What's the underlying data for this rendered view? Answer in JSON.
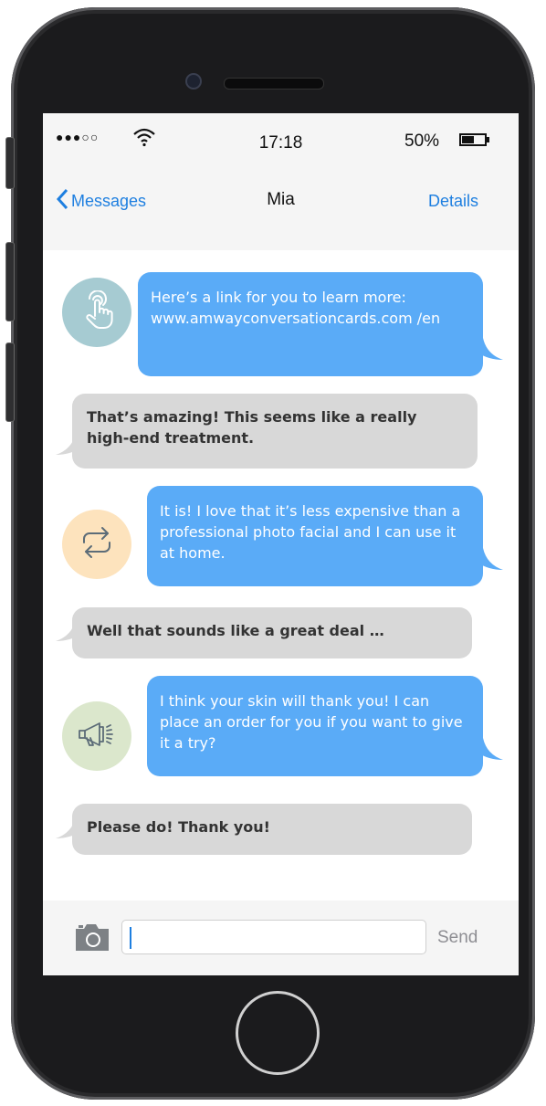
{
  "status_bar": {
    "signal": "●●●○○",
    "time": "17:18",
    "battery_pct": "50%"
  },
  "nav": {
    "back_label": "Messages",
    "title": "Mia",
    "details_label": "Details"
  },
  "messages": [
    {
      "direction": "out",
      "avatar_icon": "pointing-hand-icon",
      "text": "Here’s a link for you to learn more: www.amwayconversationcards.com /en"
    },
    {
      "direction": "in",
      "text": "That’s amazing! This seems like a really high-end treatment."
    },
    {
      "direction": "out",
      "avatar_icon": "repeat-arrows-icon",
      "text": "It is! I love that it’s less expensive than a professional photo facial and I can use it at home."
    },
    {
      "direction": "in",
      "text": "Well that sounds like a great deal …"
    },
    {
      "direction": "out",
      "avatar_icon": "megaphone-icon",
      "text": "I think your skin will thank you! I can place an order for you if you want to give it a try?"
    },
    {
      "direction": "in",
      "text": "Please do! Thank you!"
    }
  ],
  "input_bar": {
    "value": "",
    "send_label": "Send"
  },
  "colors": {
    "outgoing_bubble": "#5aabf7",
    "incoming_bubble": "#d8d8d8",
    "accent": "#1e7fe0",
    "avatar_teal": "#a6cbd2",
    "avatar_peach": "#fde3bd",
    "avatar_green": "#dbe7cc"
  }
}
